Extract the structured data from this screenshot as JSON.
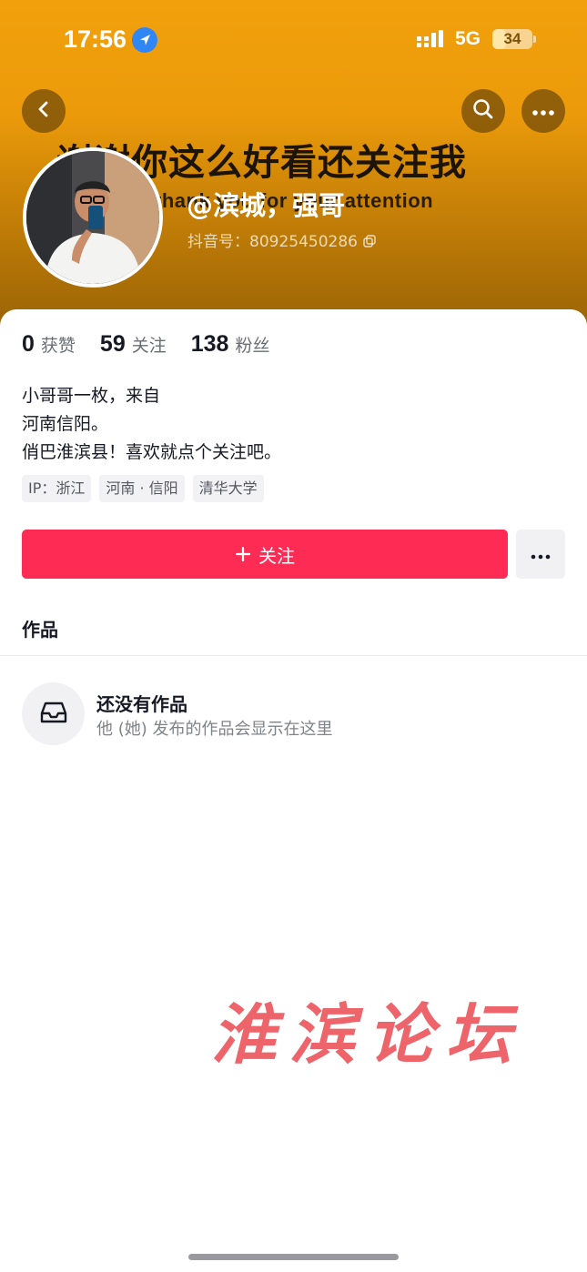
{
  "status_bar": {
    "time": "17:56",
    "network": "5G",
    "battery": "34",
    "battery_level": 0.34,
    "location_icon": "location-arrow-icon",
    "signal_icon": "signal-bars-icon"
  },
  "banner": {
    "slogan": "谢谢你这么好看还关注我",
    "slogan_sub": "thank you for your attention"
  },
  "nav": {
    "back_icon": "chevron-left-icon",
    "search_icon": "search-icon",
    "more_icon": "more-dots-icon"
  },
  "profile": {
    "username": "@滨城，强哥",
    "douyin_id": "抖音号：80925450286",
    "copy_icon": "copy-icon"
  },
  "stats": [
    {
      "num": "0",
      "label": "获赞"
    },
    {
      "num": "59",
      "label": "关注"
    },
    {
      "num": "138",
      "label": "粉丝"
    }
  ],
  "bio": [
    "小哥哥一枚，来自",
    "河南信阳。",
    "俏巴淮滨县！喜欢就点个关注吧。"
  ],
  "tags": [
    "IP：浙江",
    "河南 · 信阳",
    "清华大学"
  ],
  "actions": {
    "follow_label": "关注",
    "follow_icon": "plus-icon",
    "more_icon": "more-dots-icon"
  },
  "tabs": {
    "works": "作品"
  },
  "empty_state": {
    "icon": "inbox-tray-icon",
    "title": "还没有作品",
    "subtitle": "他 (她) 发布的作品会显示在这里"
  },
  "watermark": "淮滨论坛",
  "colors": {
    "accent": "#fe2c55",
    "banner": "#f2a10c",
    "watermark": "#ec4f56"
  }
}
